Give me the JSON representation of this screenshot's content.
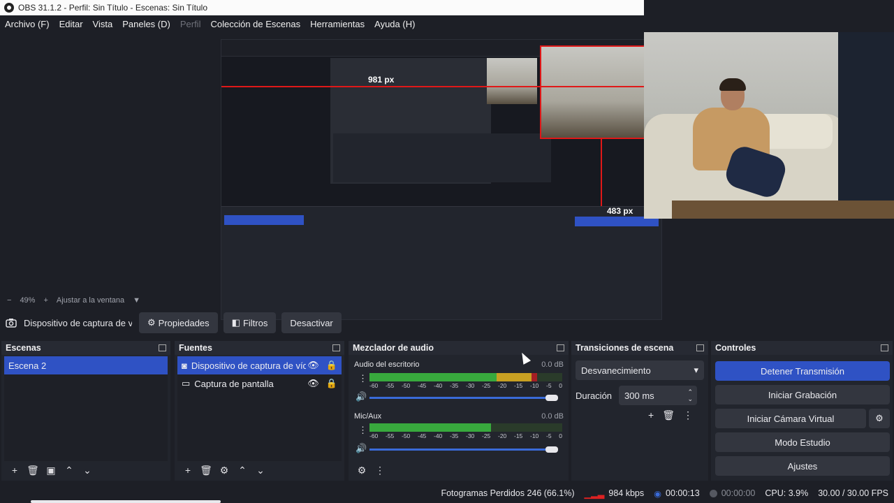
{
  "window": {
    "title": "OBS 31.1.2 - Perfil: Sin Título - Escenas: Sin Título"
  },
  "menu": [
    "Archivo (F)",
    "Editar",
    "Vista",
    "Paneles (D)",
    "Perfil",
    "Colección de Escenas",
    "Herramientas",
    "Ayuda (H)"
  ],
  "preview": {
    "measure_width": "981 px",
    "measure_height": "483 px",
    "zoom": "49%",
    "fit_label": "Ajustar a la ventana"
  },
  "source_toolbar": {
    "source_name": "Dispositivo de captura de v",
    "properties": "Propiedades",
    "filters": "Filtros",
    "deactivate": "Desactivar"
  },
  "scenes": {
    "title": "Escenas",
    "items": [
      "Escena 2"
    ],
    "selected": 0
  },
  "sources": {
    "title": "Fuentes",
    "items": [
      "Dispositivo de captura de vídeo",
      "Captura de pantalla"
    ],
    "selected": 0
  },
  "mixer": {
    "title": "Mezclador de audio",
    "channels": [
      {
        "name": "Audio del escritorio",
        "db": "0.0 dB",
        "level": 0.87,
        "volume": 1.0
      },
      {
        "name": "Mic/Aux",
        "db": "0.0 dB",
        "level": 0.63,
        "volume": 1.0
      }
    ],
    "scale": [
      "-60",
      "-55",
      "-50",
      "-45",
      "-40",
      "-35",
      "-30",
      "-25",
      "-20",
      "-15",
      "-10",
      "-5",
      "0"
    ]
  },
  "transitions": {
    "title": "Transiciones de escena",
    "selected": "Desvanecimiento",
    "duration_label": "Duración",
    "duration_value": "300 ms"
  },
  "controls": {
    "title": "Controles",
    "buttons": [
      "Detener Transmisión",
      "Iniciar Grabación",
      "Iniciar Cámara Virtual",
      "Modo Estudio",
      "Ajustes"
    ]
  },
  "status": {
    "dropped": "Fotogramas Perdidos 246 (66.1%)",
    "bitrate": "984 kbps",
    "stream_time": "00:00:13",
    "rec_time": "00:00:00",
    "cpu": "CPU: 3.9%",
    "fps": "30.00 / 30.00 FPS"
  },
  "colors": {
    "accent": "#2f52c4",
    "meter_green": "#38a93d",
    "meter_yellow": "#c8a022",
    "meter_red": "#a51f24",
    "guide_red": "#e01818"
  }
}
